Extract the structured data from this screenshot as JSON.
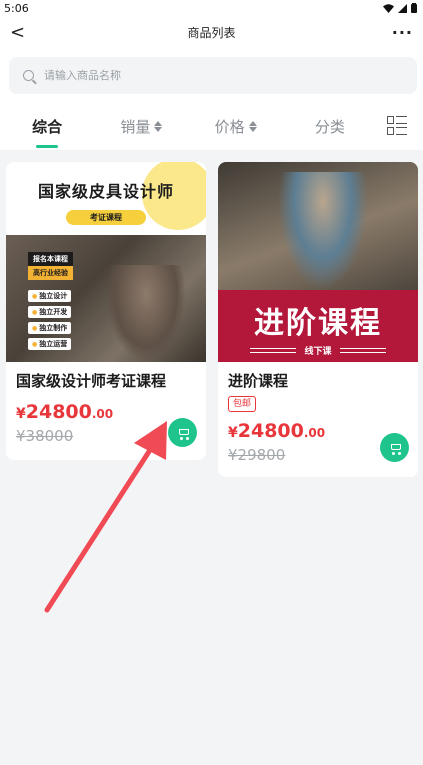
{
  "status_bar": {
    "time": "5:06"
  },
  "header": {
    "back_glyph": "<",
    "title": "商品列表",
    "more_glyph": "···"
  },
  "search": {
    "placeholder": "请输入商品名称",
    "value": ""
  },
  "tabs": [
    {
      "label": "综合",
      "active": true
    },
    {
      "label": "销量",
      "sortable": true
    },
    {
      "label": "价格",
      "sortable": true
    },
    {
      "label": "分类"
    }
  ],
  "products": [
    {
      "image": {
        "title": "国家级皮具设计师",
        "pill": "考证课程",
        "badge_a": "报名本课程",
        "badge_b": "高行业经验",
        "tags": [
          "独立设计",
          "独立开发",
          "独立制作",
          "独立运营"
        ]
      },
      "name": "国家级设计师考证课程",
      "price_currency": "¥",
      "price_integer": "24800",
      "price_decimal": ".00",
      "original_price": "¥38000",
      "tag": ""
    },
    {
      "image": {
        "title": "进阶课程",
        "subtitle": "线下课"
      },
      "name": "进阶课程",
      "price_currency": "¥",
      "price_integer": "24800",
      "price_decimal": ".00",
      "original_price": "¥29800",
      "tag": "包邮"
    }
  ],
  "colors": {
    "accent": "#1fc48d",
    "price": "#e8363a",
    "arrow": "#f04a54"
  }
}
